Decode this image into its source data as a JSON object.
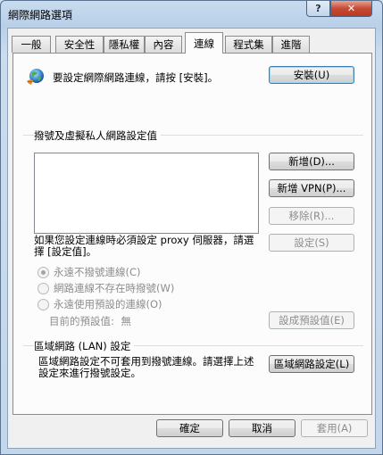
{
  "window": {
    "title": "網際網路選項",
    "help_label": "?",
    "close_label": "✕"
  },
  "tabs": [
    {
      "label": "一般",
      "active": false
    },
    {
      "label": "安全性",
      "active": false
    },
    {
      "label": "隱私權",
      "active": false
    },
    {
      "label": "內容",
      "active": false
    },
    {
      "label": "連線",
      "active": true
    },
    {
      "label": "程式集",
      "active": false
    },
    {
      "label": "進階",
      "active": false
    }
  ],
  "setup": {
    "icon": "globe-network-icon",
    "text": "要設定網際網路連線，請按 [安裝]。",
    "button": "安裝(U)"
  },
  "dialup": {
    "heading": "撥號及虛擬私人網路設定值",
    "add_button": "新增(D)...",
    "add_vpn_button": "新增 VPN(P)...",
    "remove_button": "移除(R)...",
    "proxy_text": "如果您設定連線時必須設定 proxy 伺服器，請選擇 [設定值]。",
    "settings_button": "設定(S)",
    "radio_options": [
      {
        "label": "永遠不撥號連線(C)",
        "checked": true
      },
      {
        "label": "網路連線不存在時撥號(W)",
        "checked": false
      },
      {
        "label": "永遠使用預設的連線(O)",
        "checked": false
      }
    ],
    "current_default_label": "目前的預設值:",
    "current_default_value": "無",
    "set_default_button": "設成預設值(E)"
  },
  "lan": {
    "heading": "區域網路 (LAN) 設定",
    "text": "區域網路設定不可套用到撥號連線。請選擇上述設定來進行撥號設定。",
    "button": "區域網路設定(L)"
  },
  "footer": {
    "ok": "確定",
    "cancel": "取消",
    "apply": "套用(A)"
  }
}
